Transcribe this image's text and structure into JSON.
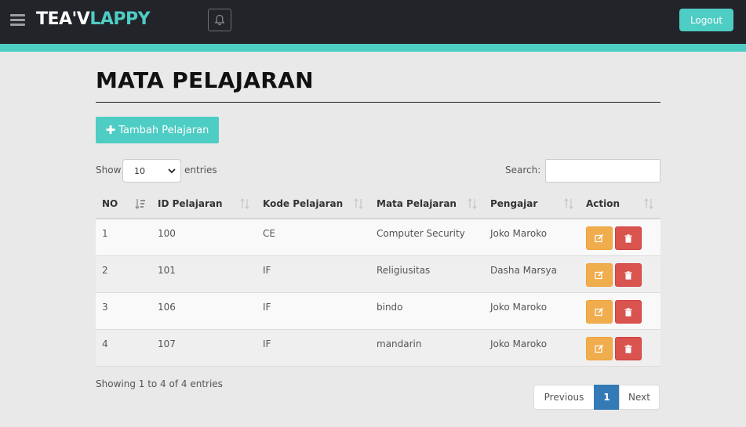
{
  "navbar": {
    "brand_part1": "TEA'V",
    "brand_part2": "LAPPY",
    "logout_label": "Logout",
    "accent_color": "#4ecdc4",
    "bg_color": "#222429"
  },
  "page": {
    "title": "MATA PELAJARAN",
    "add_button_label": "Tambah Pelajaran"
  },
  "table_controls": {
    "show_label": "Show",
    "entries_value": "10",
    "entries_label": "entries",
    "search_label": "Search:",
    "search_value": ""
  },
  "table": {
    "columns": [
      "NO",
      "ID Pelajaran",
      "Kode Pelajaran",
      "Mata Pelajaran",
      "Pengajar",
      "Action"
    ],
    "rows": [
      {
        "no": "1",
        "id": "100",
        "kode": "CE",
        "mapel": "Computer Security",
        "pengajar": "Joko Maroko"
      },
      {
        "no": "2",
        "id": "101",
        "kode": "IF",
        "mapel": "Religiusitas",
        "pengajar": "Dasha Marsya"
      },
      {
        "no": "3",
        "id": "106",
        "kode": "IF",
        "mapel": "bindo",
        "pengajar": "Joko Maroko"
      },
      {
        "no": "4",
        "id": "107",
        "kode": "IF",
        "mapel": "mandarin",
        "pengajar": "Joko Maroko"
      }
    ]
  },
  "footer": {
    "showing_text": "Showing 1 to 4 of 4 entries",
    "prev_label": "Previous",
    "current_page": "1",
    "next_label": "Next"
  },
  "icons": {
    "menu": "hamburger-icon",
    "notifications": "bell-icon",
    "add": "plus-icon",
    "edit": "edit-icon",
    "delete": "trash-icon",
    "sort": "sort-icon"
  }
}
